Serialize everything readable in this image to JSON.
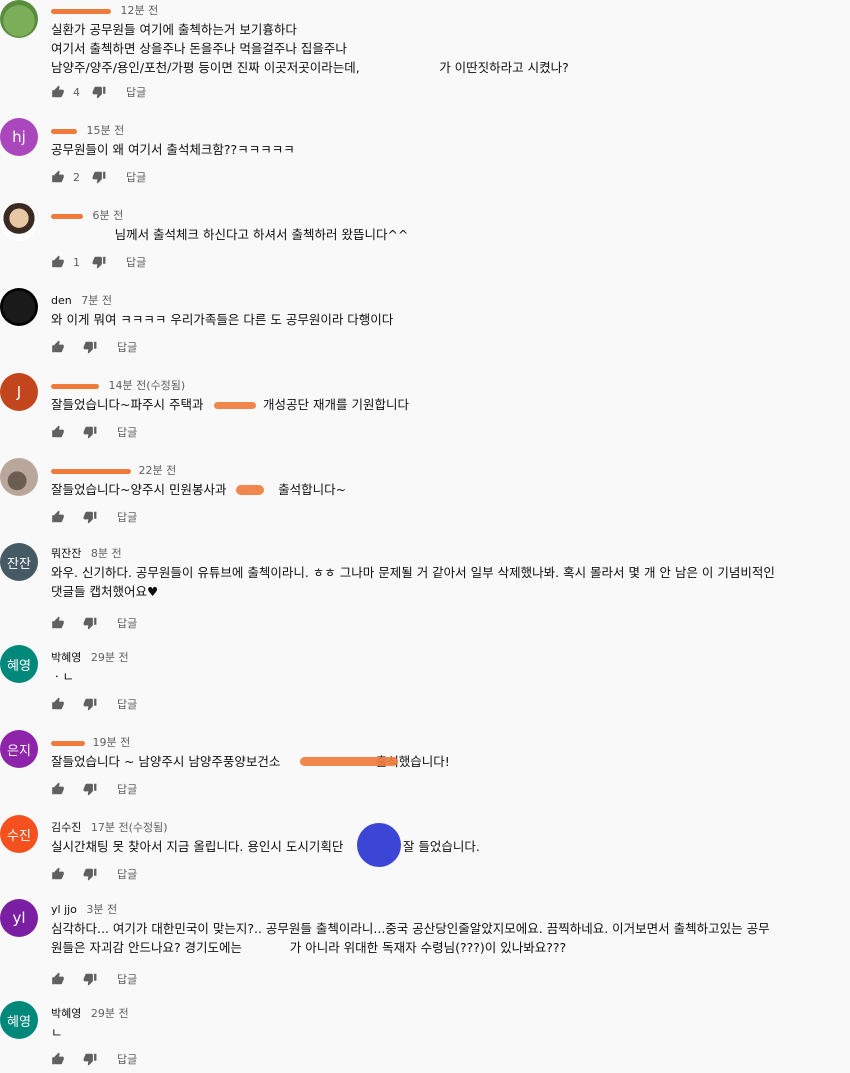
{
  "colors": {
    "background": "#f9f9f9",
    "redaction": "#f07a3a",
    "avatar_hj": "#ab47bc",
    "avatar_j": "#c2451e",
    "avatar_jjan": "#455a64",
    "avatar_hyeyoung": "#00897b",
    "avatar_eunji": "#8e24aa",
    "avatar_sujin": "#f4511e",
    "avatar_yl": "#7b1fa2",
    "blue_mark": "#3b46d6"
  },
  "icons": {
    "like": "thumbs-up-icon",
    "dislike": "thumbs-down-icon"
  },
  "comments": [
    {
      "author": "",
      "time": "12분 전",
      "avatar_text": "",
      "body": "실환가 공무원들 여기에 출첵하는거 보기흉하다\n여기서 출첵하면 상을주나 돈을주나 먹을걸주나 집을주나\n남양주/양주/용인/포천/가평 등이면 진짜 이곳저곳이라는데,                    가 이딴짓하라고 시켰나?",
      "likes": "4",
      "reply": "답글"
    },
    {
      "author": "",
      "time": "15분 전",
      "avatar_text": "hj",
      "body": "공무원들이 왜 여기서 출석체크함??ㅋㅋㅋㅋㅋ",
      "likes": "2",
      "reply": "답글"
    },
    {
      "author": "",
      "time": "6분 전",
      "avatar_text": "",
      "body": "                님께서 출석체크 하신다고 하셔서 출첵하러 왔뜹니다^^",
      "likes": "1",
      "reply": "답글"
    },
    {
      "author": "den",
      "time": "7분 전",
      "avatar_text": "",
      "body": "와 이게 뭐여 ㅋㅋㅋㅋ 우리가족들은 다른 도 공무원이라 다행이다",
      "likes": "",
      "reply": "답글"
    },
    {
      "author": "",
      "time": "14분 전(수정됨)",
      "avatar_text": "J",
      "body": "잘들었습니다~파주시 주택과               개성공단 재개를 기원합니다",
      "likes": "",
      "reply": "답글"
    },
    {
      "author": "",
      "time": "22분 전",
      "avatar_text": "",
      "body": "잘들었습니다~양주시 민원봉사과             출석합니다~",
      "likes": "",
      "reply": "답글"
    },
    {
      "author": "뭐잔잔",
      "time": "8분 전",
      "avatar_text": "잔잔",
      "body": "와우. 신기하다. 공무원들이 유튜브에 출첵이라니. ㅎㅎ 그나마 문제될 거 같아서 일부 삭제했나봐. 혹시 몰라서 몇 개 안 남은 이 기념비적인\n댓글들 캡처했어요♥",
      "likes": "",
      "reply": "답글"
    },
    {
      "author": "박혜영",
      "time": "29분 전",
      "avatar_text": "혜영",
      "body": "ㆍㄴ",
      "likes": "",
      "reply": "답글"
    },
    {
      "author": "",
      "time": "19분 전",
      "avatar_text": "은지",
      "body": "잘들었습니다 ~ 남양주시 남양주풍양보건소                        출석했습니다!",
      "likes": "",
      "reply": "답글"
    },
    {
      "author": "김수진",
      "time": "17분 전(수정됨)",
      "avatar_text": "수진",
      "body": "실시간채팅 못 찾아서 지금 올립니다. 용인시 도시기획단               잘 들었습니다.",
      "likes": "",
      "reply": "답글"
    },
    {
      "author": "yl jjo",
      "time": "3분 전",
      "avatar_text": "yl",
      "body": "심각하다... 여기가 대한민국이 맞는지?.. 공무원들 출첵이라니...중국 공산당인줄알았지모에요. 끔찍하네요. 이거보면서 출첵하고있는 공무\n원들은 자괴감 안드나요? 경기도에는            가 아니라 위대한 독재자 수령님(???)이 있나봐요???",
      "likes": "",
      "reply": "답글"
    },
    {
      "author": "박혜영",
      "time": "29분 전",
      "avatar_text": "혜영",
      "body": "ㄴ",
      "likes": "",
      "reply": "답글"
    }
  ]
}
